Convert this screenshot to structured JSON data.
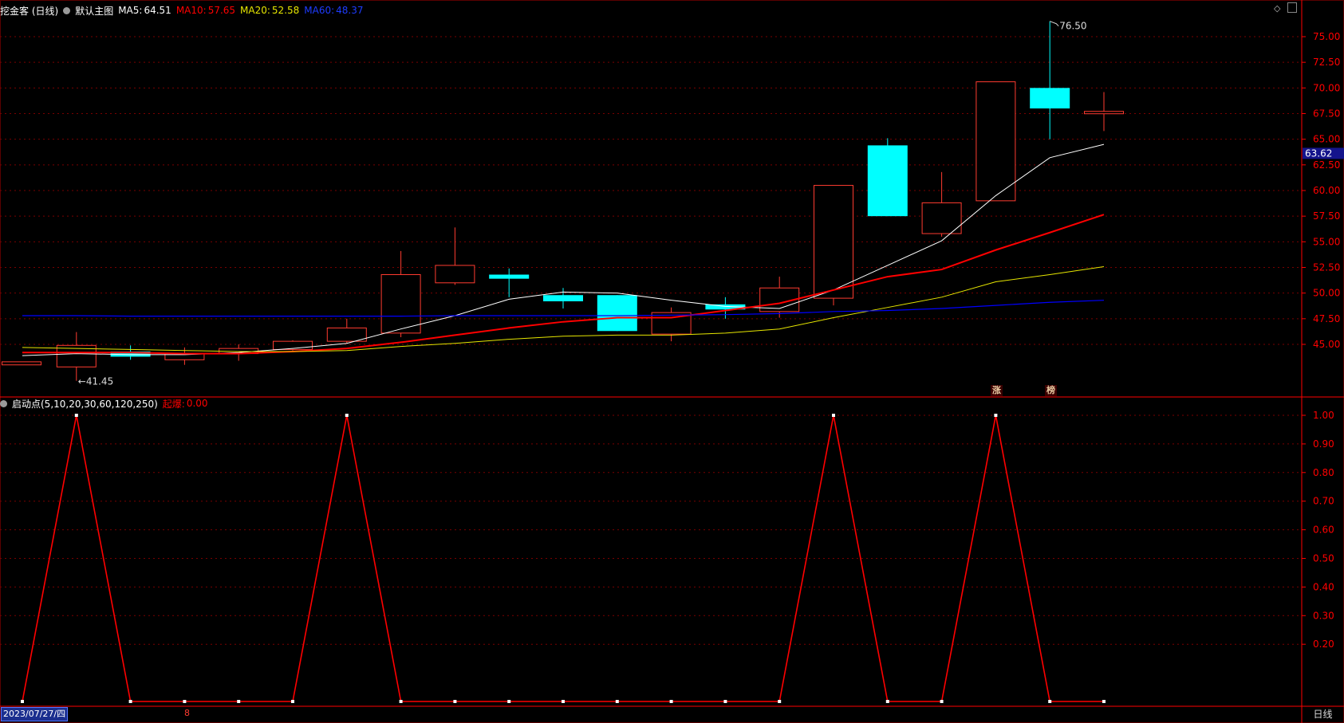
{
  "header": {
    "stock": "挖金客 (日线)",
    "template": "默认主图",
    "ma5_label": "MA5:",
    "ma5_value": "64.51",
    "ma10_label": "MA10:",
    "ma10_value": "57.65",
    "ma20_label": "MA20:",
    "ma20_value": "52.58",
    "ma60_label": "MA60:",
    "ma60_value": "48.37"
  },
  "indicator": {
    "name": "启动点(5,10,20,30,60,120,250)",
    "series_label": "起爆:",
    "series_value": "0.00"
  },
  "footer": {
    "date": "2023/07/27/四",
    "marker": "8",
    "period": "日线"
  },
  "tags": {
    "zhang": "涨",
    "bang": "榜"
  },
  "colors": {
    "up": "#ff3b30",
    "down": "#00ffff",
    "ma5": "#ffffff",
    "ma10": "#ff0000",
    "ma20": "#e6e600",
    "ma60": "#0000ff",
    "signal": "#ff0000",
    "grid": "#7a0000",
    "axis": "#ff0000"
  },
  "chart_data": [
    {
      "type": "candlestick",
      "ylim": [
        40.0,
        77.5
      ],
      "yticks": [
        "45.00",
        "47.50",
        "50.00",
        "52.50",
        "55.00",
        "57.50",
        "60.00",
        "62.50",
        "65.00",
        "67.50",
        "70.00",
        "72.50",
        "75.00"
      ],
      "current_price": "63.62",
      "annotations": {
        "high": "76.50",
        "low": "41.45"
      },
      "candles": [
        {
          "o": 43.0,
          "c": 43.3,
          "h": 43.3,
          "l": 43.0
        },
        {
          "o": 42.8,
          "c": 44.9,
          "h": 46.2,
          "l": 41.45
        },
        {
          "o": 44.3,
          "c": 43.8,
          "h": 44.9,
          "l": 43.5
        },
        {
          "o": 43.5,
          "c": 44.1,
          "h": 44.7,
          "l": 43.0
        },
        {
          "o": 44.1,
          "c": 44.6,
          "h": 45.0,
          "l": 43.4
        },
        {
          "o": 44.5,
          "c": 45.3,
          "h": 45.4,
          "l": 44.4
        },
        {
          "o": 45.3,
          "c": 46.6,
          "h": 47.5,
          "l": 45.1
        },
        {
          "o": 46.1,
          "c": 51.8,
          "h": 54.1,
          "l": 45.7
        },
        {
          "o": 51.0,
          "c": 52.7,
          "h": 56.4,
          "l": 50.8
        },
        {
          "o": 51.8,
          "c": 51.4,
          "h": 52.4,
          "l": 49.6
        },
        {
          "o": 49.8,
          "c": 49.2,
          "h": 50.5,
          "l": 48.5
        },
        {
          "o": 49.8,
          "c": 46.3,
          "h": 49.8,
          "l": 46.3
        },
        {
          "o": 46.0,
          "c": 48.1,
          "h": 48.6,
          "l": 45.3
        },
        {
          "o": 48.9,
          "c": 48.4,
          "h": 49.6,
          "l": 47.5
        },
        {
          "o": 48.2,
          "c": 50.5,
          "h": 51.6,
          "l": 47.6
        },
        {
          "o": 49.5,
          "c": 60.5,
          "h": 60.5,
          "l": 48.8
        },
        {
          "o": 64.4,
          "c": 57.5,
          "h": 65.1,
          "l": 57.5
        },
        {
          "o": 55.8,
          "c": 58.8,
          "h": 61.8,
          "l": 55.5
        },
        {
          "o": 59.0,
          "c": 70.6,
          "h": 70.6,
          "l": 59.0
        },
        {
          "o": 70.0,
          "c": 68.0,
          "h": 76.5,
          "l": 65.0
        },
        {
          "o": 67.6,
          "c": 67.6,
          "h": 69.6,
          "l": 65.8
        }
      ],
      "series": [
        {
          "name": "MA5",
          "values": [
            43.9,
            44.1,
            44.0,
            44.0,
            44.2,
            44.6,
            45.1,
            46.5,
            47.8,
            49.4,
            50.1,
            50.0,
            49.3,
            48.7,
            48.5,
            50.3,
            52.7,
            55.1,
            59.5,
            63.2,
            64.5
          ]
        },
        {
          "name": "MA10",
          "values": [
            44.2,
            44.2,
            44.2,
            44.1,
            44.1,
            44.3,
            44.6,
            45.2,
            45.9,
            46.6,
            47.2,
            47.6,
            47.6,
            48.3,
            49.0,
            50.3,
            51.6,
            52.3,
            54.2,
            55.9,
            57.65
          ]
        },
        {
          "name": "MA20",
          "values": [
            44.7,
            44.6,
            44.5,
            44.4,
            44.3,
            44.3,
            44.4,
            44.8,
            45.1,
            45.5,
            45.8,
            45.9,
            45.9,
            46.1,
            46.5,
            47.6,
            48.6,
            49.6,
            51.1,
            51.8,
            52.58
          ]
        },
        {
          "name": "MA60",
          "values": [
            47.8,
            47.8,
            47.75,
            47.75,
            47.75,
            47.75,
            47.75,
            47.75,
            47.8,
            47.8,
            47.8,
            47.8,
            47.85,
            47.9,
            48.0,
            48.2,
            48.3,
            48.5,
            48.8,
            49.1,
            49.3
          ]
        }
      ]
    },
    {
      "type": "line",
      "ylim": [
        0.0,
        1.0
      ],
      "yticks": [
        "0.20",
        "0.30",
        "0.40",
        "0.50",
        "0.60",
        "0.70",
        "0.80",
        "0.90",
        "1.00"
      ],
      "series": [
        {
          "name": "起爆",
          "values": [
            0,
            1,
            0,
            0,
            0,
            0,
            1,
            0,
            0,
            0,
            0,
            0,
            0,
            0,
            0,
            1,
            0,
            0,
            1,
            0,
            0
          ]
        }
      ]
    }
  ]
}
